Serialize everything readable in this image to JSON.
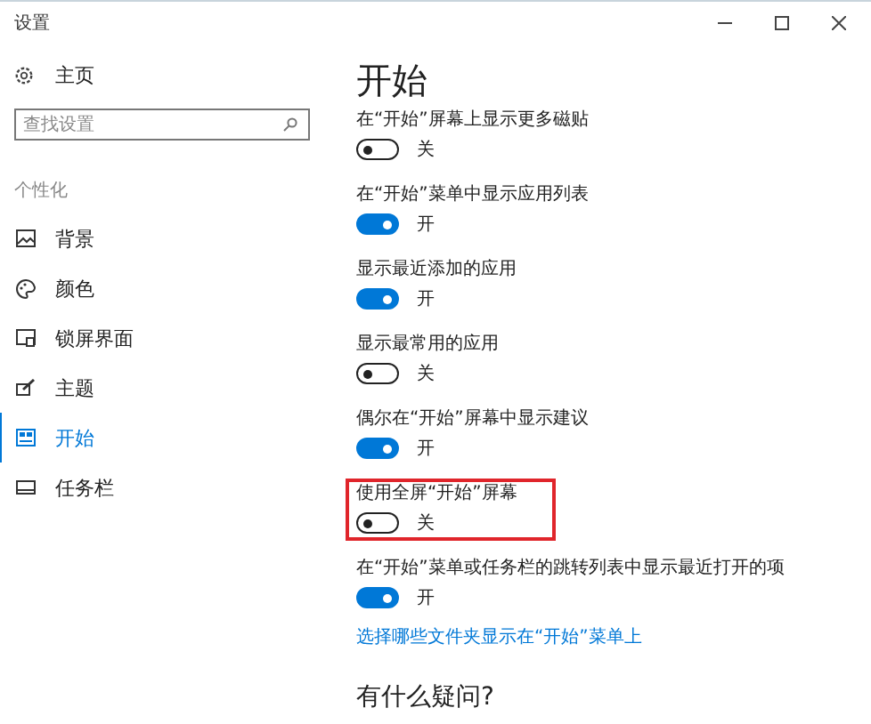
{
  "window": {
    "title": "设置"
  },
  "sidebar": {
    "home": "主页",
    "search": {
      "placeholder": "查找设置"
    },
    "section": "个性化",
    "items": [
      {
        "label": "背景",
        "selected": false
      },
      {
        "label": "颜色",
        "selected": false
      },
      {
        "label": "锁屏界面",
        "selected": false
      },
      {
        "label": "主题",
        "selected": false
      },
      {
        "label": "开始",
        "selected": true
      },
      {
        "label": "任务栏",
        "selected": false
      }
    ]
  },
  "page": {
    "title": "开始",
    "settings": [
      {
        "label": "在“开始”屏幕上显示更多磁贴",
        "on": false,
        "state": "关",
        "highlighted": false
      },
      {
        "label": "在“开始”菜单中显示应用列表",
        "on": true,
        "state": "开",
        "highlighted": false
      },
      {
        "label": "显示最近添加的应用",
        "on": true,
        "state": "开",
        "highlighted": false
      },
      {
        "label": "显示最常用的应用",
        "on": false,
        "state": "关",
        "highlighted": false
      },
      {
        "label": "偶尔在“开始”屏幕中显示建议",
        "on": true,
        "state": "开",
        "highlighted": false
      },
      {
        "label": "使用全屏“开始”屏幕",
        "on": false,
        "state": "关",
        "highlighted": true
      },
      {
        "label": "在“开始”菜单或任务栏的跳转列表中显示最近打开的项",
        "on": true,
        "state": "开",
        "highlighted": false
      }
    ],
    "link": "选择哪些文件夹显示在“开始”菜单上",
    "question": "有什么疑问?"
  }
}
